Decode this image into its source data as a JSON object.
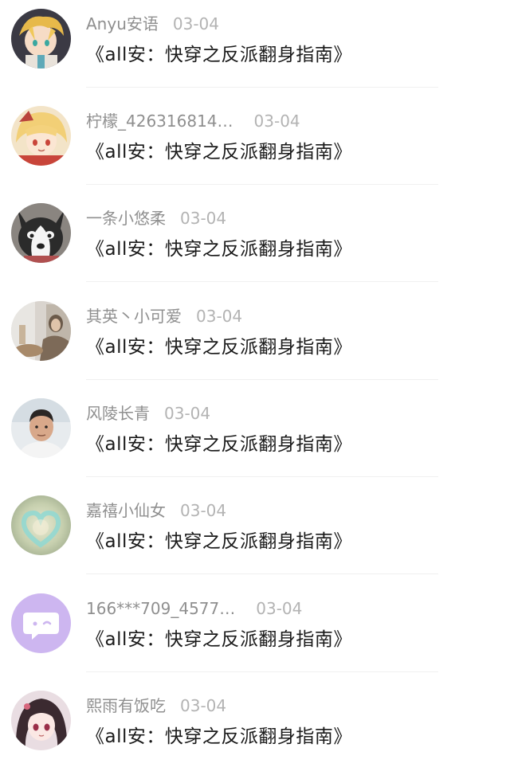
{
  "comments": [
    {
      "user": "Anyu安语",
      "date": "03-04",
      "text": "《all安：快穿之反派翻身指南》",
      "avatar_icon": "anime-boy-avatar-icon"
    },
    {
      "user": "柠檬_426316814…",
      "date": "03-04",
      "text": "《all安：快穿之反派翻身指南》",
      "avatar_icon": "anime-girl-blonde-avatar-icon"
    },
    {
      "user": "一条小悠柔",
      "date": "03-04",
      "text": "《all安：快穿之反派翻身指南》",
      "avatar_icon": "husky-dog-avatar-icon"
    },
    {
      "user": "其英丶小可爱",
      "date": "03-04",
      "text": "《all安：快穿之反派翻身指南》",
      "avatar_icon": "photo-avatar-icon"
    },
    {
      "user": "风陵长青",
      "date": "03-04",
      "text": "《all安：快穿之反派翻身指南》",
      "avatar_icon": "man-portrait-avatar-icon"
    },
    {
      "user": "嘉禧小仙女",
      "date": "03-04",
      "text": "《all安：快穿之反派翻身指南》",
      "avatar_icon": "heart-blur-avatar-icon"
    },
    {
      "user": "166***709_4577…",
      "date": "03-04",
      "text": "《all安：快穿之反派翻身指南》",
      "avatar_icon": "chat-bubble-default-avatar-icon"
    },
    {
      "user": "熙雨有饭吃",
      "date": "03-04",
      "text": "《all安：快穿之反派翻身指南》",
      "avatar_icon": "anime-girl-dark-hair-avatar-icon"
    }
  ],
  "colors": {
    "username": "#8f8f8f",
    "date": "#b3b3b3",
    "text": "#1a1a1a",
    "divider": "#f0f0f0",
    "default_avatar": "#cdb6f0"
  }
}
